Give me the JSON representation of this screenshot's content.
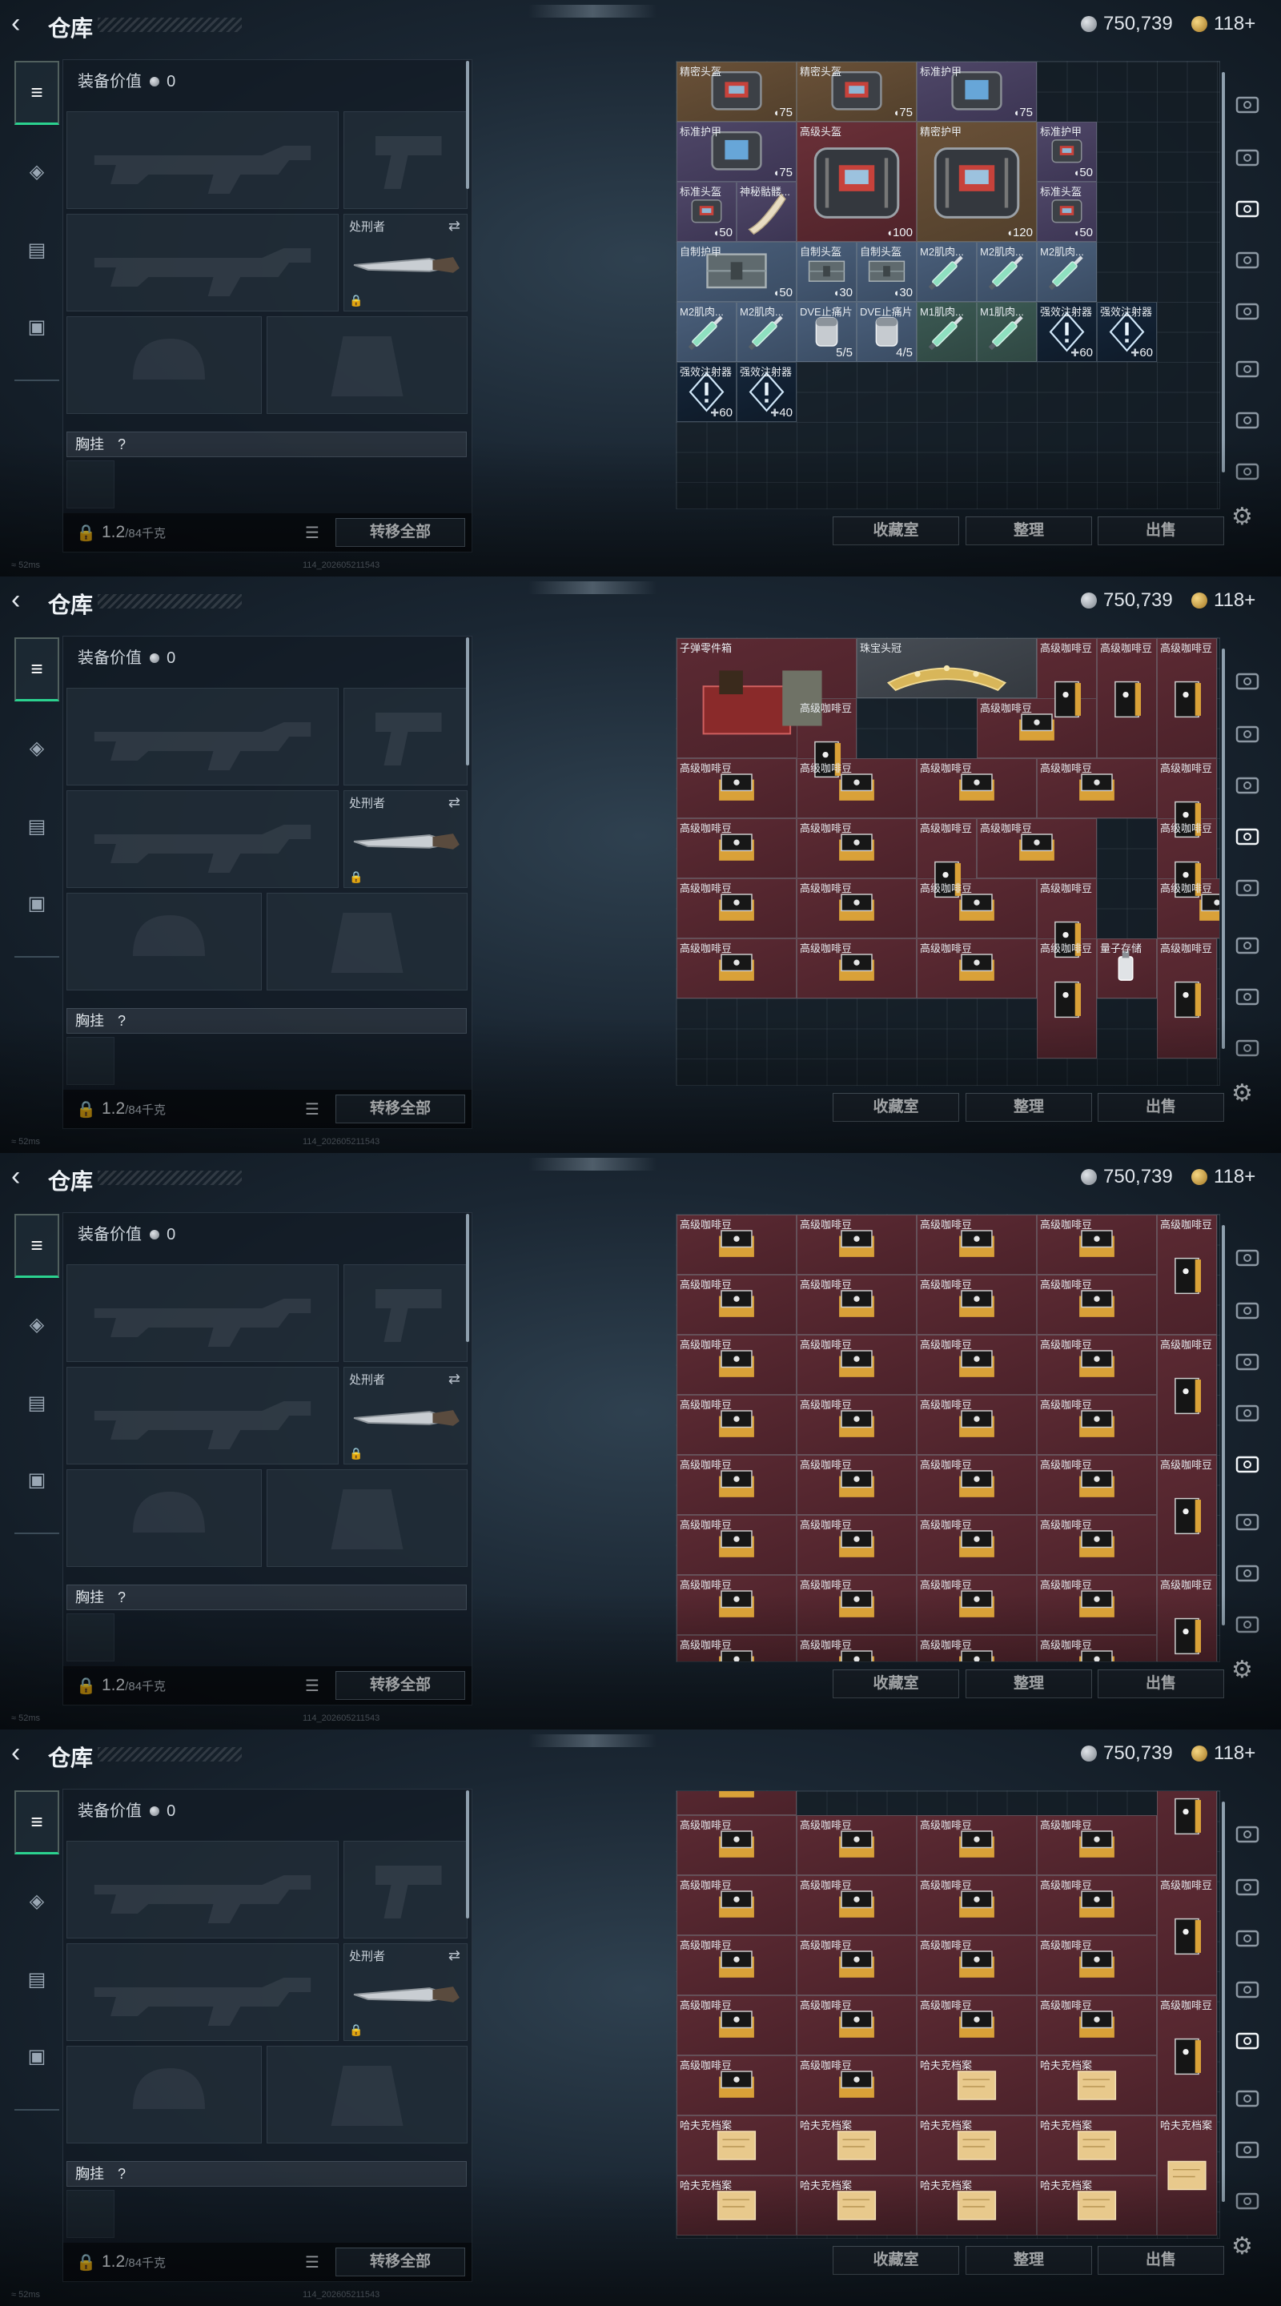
{
  "app": {
    "title": "仓库",
    "currency_silver": "750,739",
    "currency_gold": "118+",
    "back_icon": "chevron-left-icon"
  },
  "left_tabs": [
    {
      "icon": "gun-icon",
      "active": true
    },
    {
      "icon": "dogtag-icon",
      "active": false
    },
    {
      "icon": "clipboard-icon",
      "active": false
    },
    {
      "icon": "briefcase-icon",
      "active": false
    }
  ],
  "loadout": {
    "value_label": "装备价值",
    "value": "0",
    "melee_label": "处刑者",
    "chest_rig_label": "胸挂",
    "chest_rig_hint": "?",
    "weight": "1.2",
    "weight_max": "/84千克",
    "transfer_all": "转移全部"
  },
  "grid_buttons": {
    "collection": "收藏室",
    "sort": "整理",
    "sell": "出售"
  },
  "footer": {
    "ping": "52ms",
    "build": "114_202605211543"
  },
  "screens": [
    {
      "items": [
        {
          "name": "精密头盔",
          "value": "75",
          "kind": "shield",
          "color": "orange",
          "art": "bag"
        },
        {
          "name": "精密头盔",
          "value": "75",
          "kind": "shield",
          "color": "orange",
          "art": "bag"
        },
        {
          "name": "标准护甲",
          "value": "75",
          "kind": "shield",
          "color": "purple",
          "art": "bagblue"
        },
        {
          "name": "标准护甲",
          "value": "75",
          "kind": "shield",
          "color": "purple",
          "art": "bagblue"
        },
        {
          "name": "高级头盔",
          "value": "100",
          "kind": "shield",
          "color": "red",
          "art": "bigbag"
        },
        {
          "name": "精密护甲",
          "value": "120",
          "kind": "shield",
          "color": "orange",
          "art": "bigbag"
        },
        {
          "name": "标准护甲",
          "value": "50",
          "kind": "shield",
          "color": "purple",
          "art": "bag"
        },
        {
          "name": "标准头盔",
          "value": "50",
          "kind": "shield",
          "color": "purple",
          "art": "bag"
        },
        {
          "name": "神秘骷髅...",
          "value": "",
          "kind": "",
          "color": "purple",
          "art": "horn"
        },
        {
          "name": "标准头盔",
          "value": "50",
          "kind": "shield",
          "color": "purple",
          "art": "bag"
        },
        {
          "name": "自制护甲",
          "value": "50",
          "kind": "shield",
          "color": "blue",
          "art": "crate"
        },
        {
          "name": "自制头盔",
          "value": "30",
          "kind": "shield",
          "color": "blue",
          "art": "crate"
        },
        {
          "name": "自制头盔",
          "value": "30",
          "kind": "shield",
          "color": "blue",
          "art": "crate"
        },
        {
          "name": "M2肌肉...",
          "value": "",
          "kind": "",
          "color": "blue",
          "art": "syringe"
        },
        {
          "name": "M2肌肉...",
          "value": "",
          "kind": "",
          "color": "blue",
          "art": "syringe"
        },
        {
          "name": "M2肌肉...",
          "value": "",
          "kind": "",
          "color": "blue",
          "art": "syringe"
        },
        {
          "name": "M2肌肉...",
          "value": "",
          "kind": "",
          "color": "blue",
          "art": "syringe"
        },
        {
          "name": "M2肌肉...",
          "value": "",
          "kind": "",
          "color": "blue",
          "art": "syringe"
        },
        {
          "name": "DVE止痛片",
          "value": "5/5",
          "kind": "",
          "color": "blue",
          "art": "pill"
        },
        {
          "name": "DVE止痛片",
          "value": "4/5",
          "kind": "",
          "color": "blue",
          "art": "pill"
        },
        {
          "name": "M1肌肉...",
          "value": "",
          "kind": "",
          "color": "green",
          "art": "syringe"
        },
        {
          "name": "M1肌肉...",
          "value": "",
          "kind": "",
          "color": "green",
          "art": "syringe"
        },
        {
          "name": "强效注射器",
          "value": "60",
          "kind": "plus",
          "color": "dark",
          "art": "inject"
        },
        {
          "name": "强效注射器",
          "value": "60",
          "kind": "plus",
          "color": "dark",
          "art": "inject"
        },
        {
          "name": "强效注射器",
          "value": "60",
          "kind": "plus",
          "color": "dark",
          "art": "inject"
        },
        {
          "name": "强效注射器",
          "value": "40",
          "kind": "plus",
          "color": "dark",
          "art": "inject"
        }
      ]
    },
    {
      "items": [
        {
          "name": "子弹零件箱",
          "value": "",
          "color": "maroon",
          "art": "ammo"
        },
        {
          "name": "珠宝头冠",
          "value": "",
          "color": "gray",
          "art": "crown"
        },
        {
          "name": "高级咖啡豆",
          "value": "",
          "color": "maroon",
          "art": "coffee"
        },
        {
          "name": "高级咖啡豆",
          "value": "",
          "color": "maroon",
          "art": "coffee"
        },
        {
          "name": "高级咖啡豆",
          "value": "",
          "color": "maroon",
          "art": "coffee"
        },
        {
          "name": "高级咖啡豆",
          "value": "",
          "color": "maroon",
          "art": "coffee"
        },
        {
          "name": "量子存储",
          "value": "",
          "color": "maroon",
          "art": "usb"
        }
      ]
    },
    {
      "items": [
        {
          "name": "高级咖啡豆",
          "value": "",
          "color": "maroon",
          "art": "coffee"
        }
      ]
    },
    {
      "items": [
        {
          "name": "高级咖啡豆",
          "value": "",
          "color": "maroon",
          "art": "coffee"
        },
        {
          "name": "哈夫克档案",
          "value": "",
          "color": "maroon",
          "art": "file"
        }
      ]
    }
  ]
}
